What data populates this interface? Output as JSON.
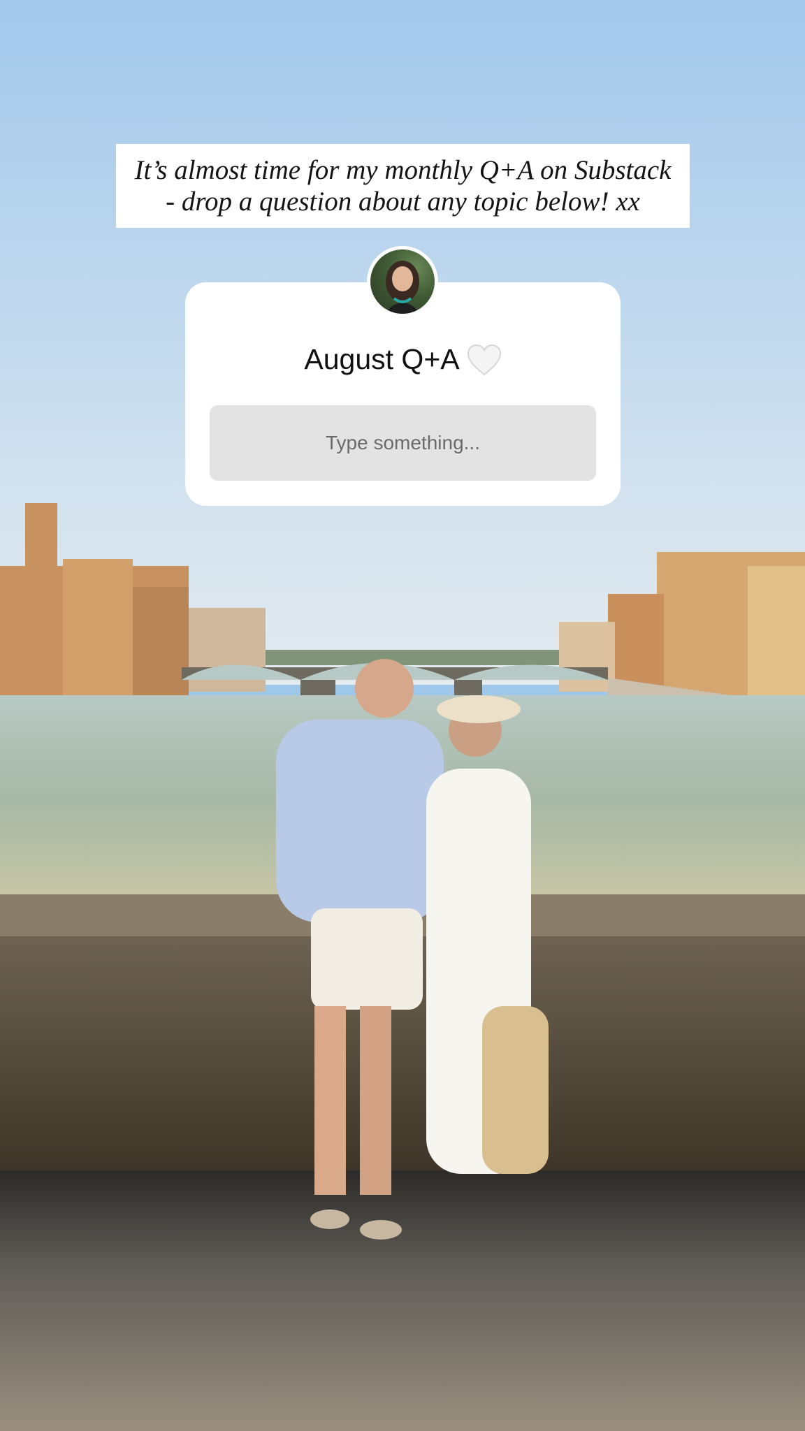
{
  "story": {
    "caption_line1": "It’s almost time for my monthly Q+A on Substack",
    "caption_line2": "- drop a question about any topic below! xx"
  },
  "question_box": {
    "title": "August Q+A",
    "heart_icon": "white-heart-icon",
    "input_placeholder": "Type something...",
    "input_value": ""
  },
  "colors": {
    "sky_top": "#a9cdf0",
    "sky_bottom": "#dfe9ef",
    "card_bg": "#ffffff",
    "input_bg": "#e3e3e3",
    "placeholder_text": "#6b6b6b"
  }
}
